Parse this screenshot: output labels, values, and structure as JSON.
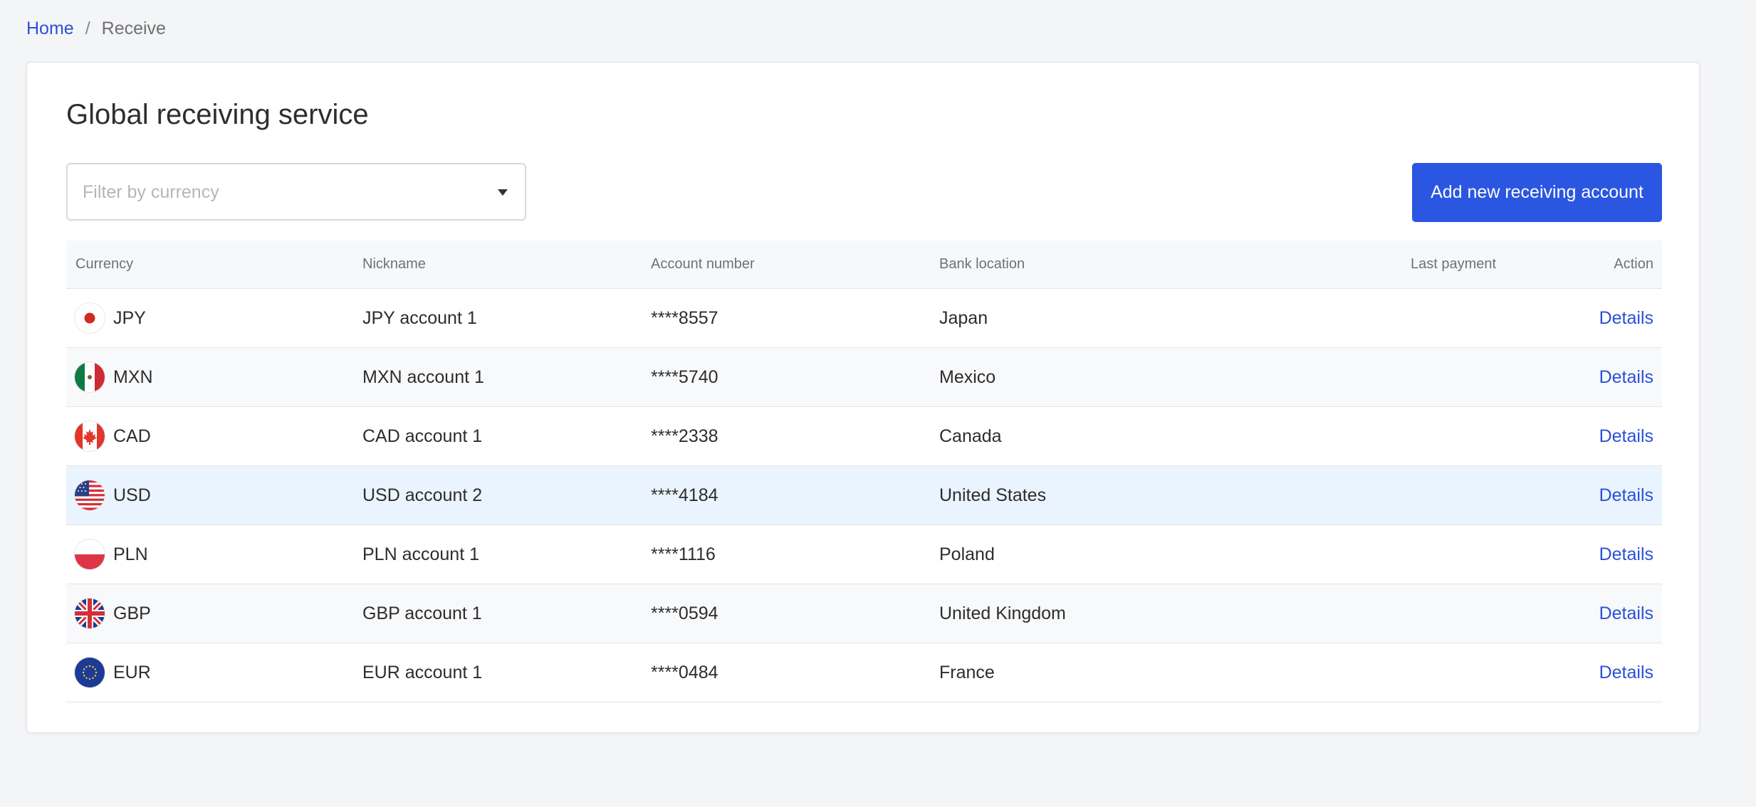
{
  "breadcrumb": {
    "home": "Home",
    "separator": "/",
    "current": "Receive"
  },
  "page": {
    "title": "Global receiving service"
  },
  "filter": {
    "placeholder": "Filter by currency"
  },
  "actions": {
    "add_button": "Add new receiving account"
  },
  "table": {
    "headers": {
      "currency": "Currency",
      "nickname": "Nickname",
      "account_number": "Account number",
      "bank_location": "Bank location",
      "last_payment": "Last payment",
      "action": "Action"
    },
    "rows": [
      {
        "flag": "japan-flag-icon",
        "currency": "JPY",
        "nickname": "JPY account 1",
        "account_number": "****8557",
        "bank_location": "Japan",
        "last_payment": "",
        "action": "Details"
      },
      {
        "flag": "mexico-flag-icon",
        "currency": "MXN",
        "nickname": "MXN account 1",
        "account_number": "****5740",
        "bank_location": "Mexico",
        "last_payment": "",
        "action": "Details"
      },
      {
        "flag": "canada-flag-icon",
        "currency": "CAD",
        "nickname": "CAD account 1",
        "account_number": "****2338",
        "bank_location": "Canada",
        "last_payment": "",
        "action": "Details"
      },
      {
        "flag": "usa-flag-icon",
        "currency": "USD",
        "nickname": "USD account 2",
        "account_number": "****4184",
        "bank_location": "United States",
        "last_payment": "",
        "action": "Details"
      },
      {
        "flag": "poland-flag-icon",
        "currency": "PLN",
        "nickname": "PLN account 1",
        "account_number": "****1116",
        "bank_location": "Poland",
        "last_payment": "",
        "action": "Details"
      },
      {
        "flag": "uk-flag-icon",
        "currency": "GBP",
        "nickname": "GBP account 1",
        "account_number": "****0594",
        "bank_location": "United Kingdom",
        "last_payment": "",
        "action": "Details"
      },
      {
        "flag": "eu-flag-icon",
        "currency": "EUR",
        "nickname": "EUR account 1",
        "account_number": "****0484",
        "bank_location": "France",
        "last_payment": "",
        "action": "Details"
      }
    ]
  },
  "colors": {
    "accent": "#2a56e2",
    "link": "#2b50d6",
    "row_highlight": "#eaf4fe",
    "page_background": "#f4f5f7"
  }
}
